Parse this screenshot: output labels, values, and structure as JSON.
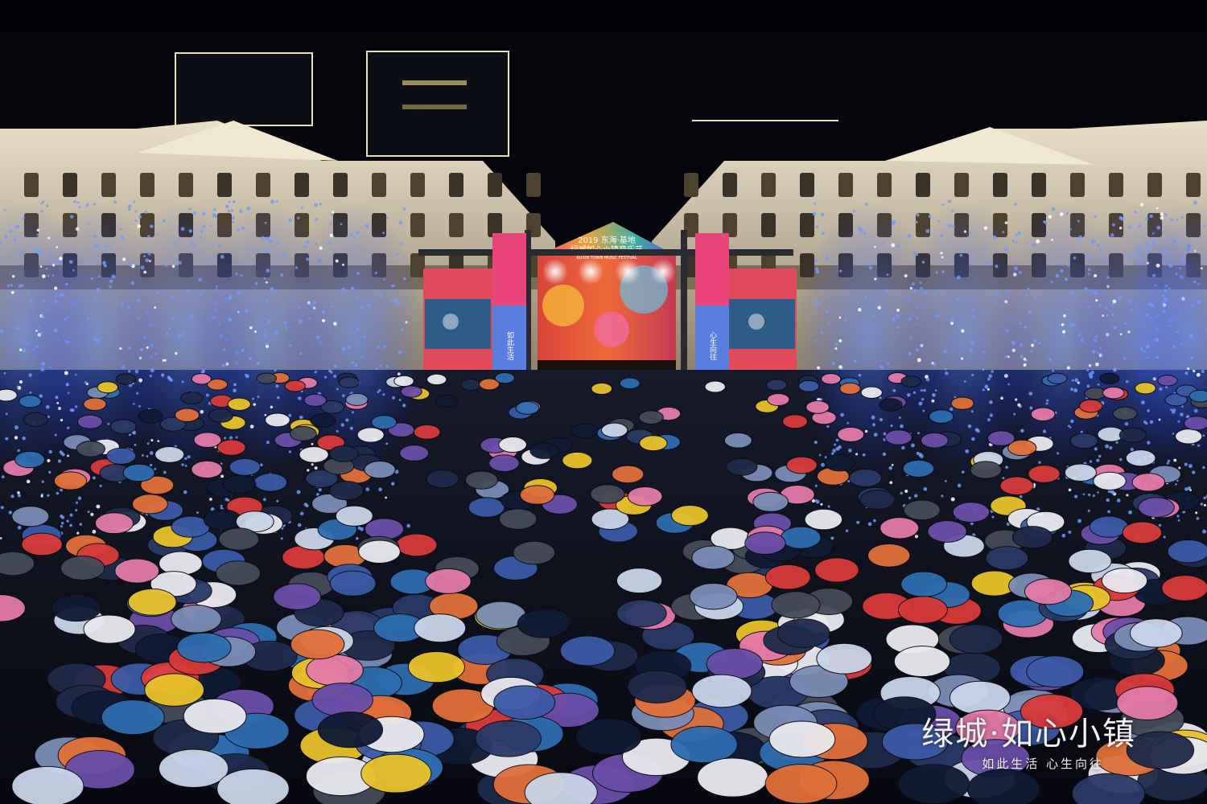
{
  "scene": {
    "description_colors": {
      "sky": "#05060c",
      "facade": "#d9cdb4",
      "tree_lights": "#2f6dff",
      "stage_red": "#e23a3a",
      "screen_blue": "#2e8bd6"
    }
  },
  "stage": {
    "banner_line1": "2019 东海·基地",
    "banner_line2": "绿城如心小镇音乐节",
    "banner_line3": "RUXIN TOWN MUSIC FESTIVAL"
  },
  "pillars": {
    "left_text": "如此生活",
    "right_text": "心生向往"
  },
  "watermark": {
    "title": "绿城·如心小镇",
    "slogan": "如此生活 心生向往"
  }
}
